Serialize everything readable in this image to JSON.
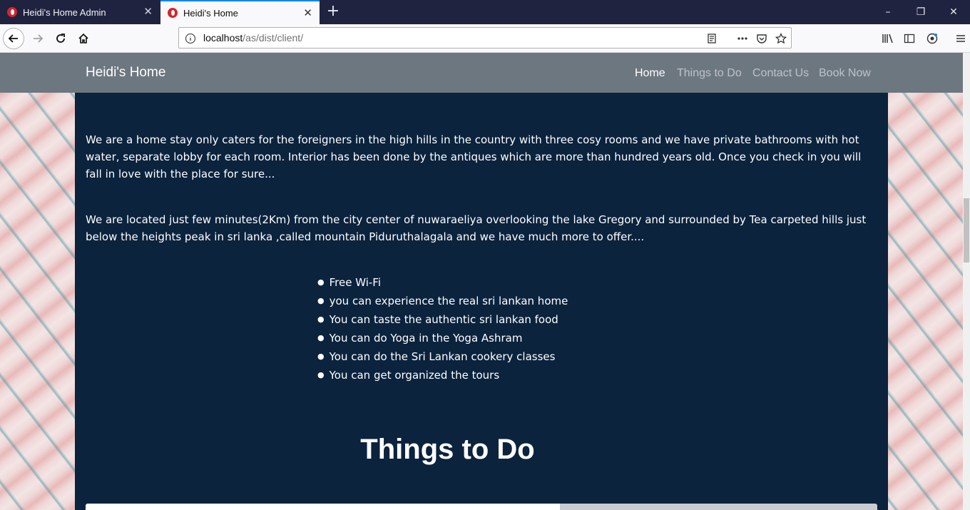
{
  "browser": {
    "tabs": [
      {
        "title": "Heidi's Home Admin",
        "active": false
      },
      {
        "title": "Heidi's Home",
        "active": true
      }
    ],
    "new_tab": "+",
    "url_host": "localhost",
    "url_path": "/as/dist/client/",
    "window_controls": {
      "minimize": "–",
      "restore": "❐",
      "close": "✕"
    }
  },
  "site": {
    "brand": "Heidi's Home",
    "nav": [
      "Home",
      "Things to Do",
      "Contact Us",
      "Book Now"
    ],
    "active_nav": "Home"
  },
  "content": {
    "intro": "We are a home stay only caters for the foreigners in the high hills in the country with three cosy rooms and we have private bathrooms with hot water, separate lobby for each room. Interior has been done by the antiques which are more than hundred years old. Once you check in you will fall in love with the place for sure...",
    "location": "We are located just few minutes(2Km) from the city center of nuwaraeliya overlooking the lake Gregory and surrounded by Tea carpeted hills just below the heights peak in sri lanka ,called mountain Piduruthalagala and we have much more to offer....",
    "features": [
      "Free Wi-Fi",
      "you can experience the real sri lankan home",
      "You can taste the authentic sri lankan food",
      "You can do Yoga in the Yoga Ashram",
      "You can do the Sri Lankan cookery classes",
      "You can get organized the tours"
    ],
    "section_title": "Things to Do"
  },
  "colors": {
    "content_bg": "#0b233d",
    "navbar_bg": "#6d7780",
    "tab_strip": "#202340",
    "accent": "#0a84ff"
  }
}
